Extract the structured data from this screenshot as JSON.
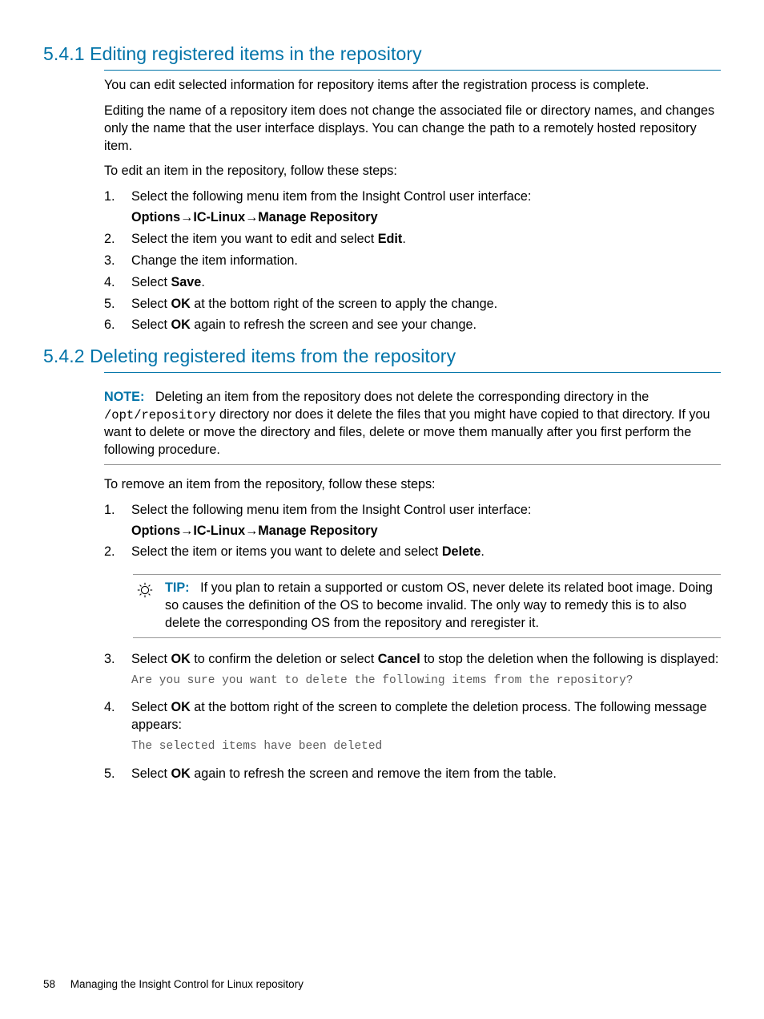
{
  "section541": {
    "heading": "5.4.1 Editing registered items in the repository",
    "p1": "You can edit selected information for repository items after the registration process is complete.",
    "p2": "Editing the name of a repository item does not change the associated file or directory names, and changes only the name that the user interface displays. You can change the path to a remotely hosted repository item.",
    "p3": "To edit an item in the repository, follow these steps:",
    "steps": {
      "s1": {
        "num": "1.",
        "text": "Select the following menu item from the Insight Control user interface:",
        "path_a": "Options",
        "path_b": "IC-Linux",
        "path_c": "Manage Repository"
      },
      "s2": {
        "num": "2.",
        "pre": "Select the item you want to edit and select ",
        "bold": "Edit",
        "post": "."
      },
      "s3": {
        "num": "3.",
        "text": "Change the item information."
      },
      "s4": {
        "num": "4.",
        "pre": "Select ",
        "bold": "Save",
        "post": "."
      },
      "s5": {
        "num": "5.",
        "pre": "Select ",
        "bold": "OK",
        "post": " at the bottom right of the screen to apply the change."
      },
      "s6": {
        "num": "6.",
        "pre": "Select ",
        "bold": "OK",
        "post": " again to refresh the screen and see your change."
      }
    }
  },
  "section542": {
    "heading": "5.4.2 Deleting registered items from the repository",
    "note": {
      "label": "NOTE:",
      "pre": "Deleting an item from the repository does not delete the corresponding directory in the ",
      "mono": "/opt/repository",
      "post": " directory nor does it delete the files that you might have copied to that directory. If you want to delete or move the directory and files, delete or move them manually after you first perform the following procedure."
    },
    "p1": "To remove an item from the repository, follow these steps:",
    "steps": {
      "s1": {
        "num": "1.",
        "text": "Select the following menu item from the Insight Control user interface:",
        "path_a": "Options",
        "path_b": "IC-Linux",
        "path_c": "Manage Repository"
      },
      "s2": {
        "num": "2.",
        "pre": "Select the item or items you want to delete and select ",
        "bold": "Delete",
        "post": "."
      }
    },
    "tip": {
      "label": "TIP:",
      "text": "If you plan to retain a supported or custom OS, never delete its related boot image. Doing so causes the definition of the OS to become invalid. The only way to remedy this is to also delete the corresponding OS from the repository and reregister it."
    },
    "steps2": {
      "s3": {
        "num": "3.",
        "pre": "Select ",
        "bold1": "OK",
        "mid": " to confirm the deletion or select ",
        "bold2": "Cancel",
        "post": " to stop the deletion when the following is displayed:",
        "code": "Are you sure you want to delete the following items from the repository?"
      },
      "s4": {
        "num": "4.",
        "pre": "Select ",
        "bold": "OK",
        "post": " at the bottom right of the screen to complete the deletion process. The following message appears:",
        "code": "The selected items have been deleted"
      },
      "s5": {
        "num": "5.",
        "pre": "Select ",
        "bold": "OK",
        "post": " again to refresh the screen and remove the item from the table."
      }
    }
  },
  "footer": {
    "page": "58",
    "title": "Managing the Insight Control for Linux repository"
  },
  "glyphs": {
    "arrow": "→"
  }
}
